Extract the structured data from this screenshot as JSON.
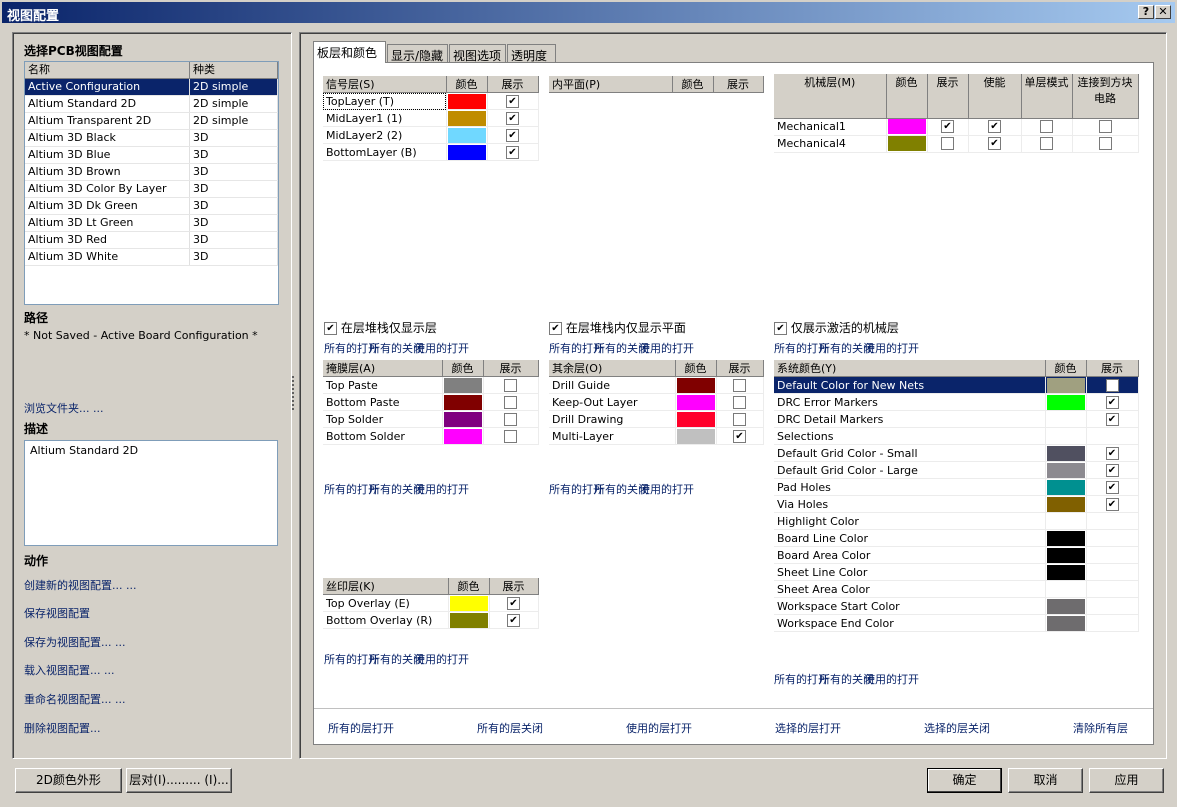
{
  "window": {
    "title": "视图配置",
    "help": "?",
    "close": "✕"
  },
  "left": {
    "heading": "选择PCB视图配置",
    "columns": [
      "名称",
      "种类"
    ],
    "configs": [
      {
        "name": "Active Configuration",
        "type": "2D simple"
      },
      {
        "name": "Altium Standard 2D",
        "type": "2D simple"
      },
      {
        "name": "Altium Transparent 2D",
        "type": "2D simple"
      },
      {
        "name": "Altium 3D Black",
        "type": "3D"
      },
      {
        "name": "Altium 3D Blue",
        "type": "3D"
      },
      {
        "name": "Altium 3D Brown",
        "type": "3D"
      },
      {
        "name": "Altium 3D Color By Layer",
        "type": "3D"
      },
      {
        "name": "Altium 3D Dk Green",
        "type": "3D"
      },
      {
        "name": "Altium 3D Lt Green",
        "type": "3D"
      },
      {
        "name": "Altium 3D Red",
        "type": "3D"
      },
      {
        "name": "Altium 3D White",
        "type": "3D"
      }
    ],
    "path_heading": "路径",
    "path_value": "* Not Saved - Active Board Configuration *",
    "browse": "浏览文件夹... ...",
    "desc_heading": "描述",
    "desc_value": "Altium Standard 2D",
    "actions_heading": "动作",
    "actions": [
      "创建新的视图配置... ...",
      "保存视图配置",
      "保存为视图配置... ...",
      "载入视图配置... ...",
      "重命名视图配置... ...",
      "删除视图配置..."
    ]
  },
  "tabs": [
    "板层和颜色",
    "显示/隐藏",
    "视图选项",
    "透明度"
  ],
  "links": {
    "all_on": "所有的打开",
    "all_off": "所有的关闭",
    "used_on": "使用的打开"
  },
  "signal": {
    "columns": [
      "信号层(S)",
      "颜色",
      "展示"
    ],
    "rows": [
      {
        "name": "TopLayer (T)",
        "color": "#ff0000",
        "checks": [
          true
        ]
      },
      {
        "name": "MidLayer1 (1)",
        "color": "#c08c00",
        "checks": [
          true
        ]
      },
      {
        "name": "MidLayer2 (2)",
        "color": "#70d8ff",
        "checks": [
          true
        ]
      },
      {
        "name": "BottomLayer (B)",
        "color": "#0000ff",
        "checks": [
          true
        ]
      }
    ]
  },
  "plane": {
    "columns": [
      "内平面(P)",
      "颜色",
      "展示"
    ],
    "rows": []
  },
  "mech": {
    "columns": [
      "机械层(M)",
      "颜色",
      "展示",
      "使能",
      "单层模式",
      "连接到方块电路"
    ],
    "rows": [
      {
        "name": "Mechanical1",
        "color": "#ff00ff",
        "checks": [
          true,
          true,
          false,
          false
        ]
      },
      {
        "name": "Mechanical4",
        "color": "#808000",
        "checks": [
          false,
          true,
          false,
          false
        ]
      }
    ]
  },
  "options": {
    "signal_only": "在层堆栈仅显示层",
    "plane_only": "在层堆栈内仅显示平面",
    "mech_only": "仅展示激活的机械层"
  },
  "mask": {
    "columns": [
      "掩膜层(A)",
      "颜色",
      "展示"
    ],
    "rows": [
      {
        "name": "Top Paste",
        "color": "#808080",
        "checks": [
          false
        ]
      },
      {
        "name": "Bottom Paste",
        "color": "#800000",
        "checks": [
          false
        ]
      },
      {
        "name": "Top Solder",
        "color": "#800080",
        "checks": [
          false
        ]
      },
      {
        "name": "Bottom Solder",
        "color": "#ff00ff",
        "checks": [
          false
        ]
      }
    ]
  },
  "other": {
    "columns": [
      "其余层(O)",
      "颜色",
      "展示"
    ],
    "rows": [
      {
        "name": "Drill Guide",
        "color": "#800000",
        "checks": [
          false
        ]
      },
      {
        "name": "Keep-Out Layer",
        "color": "#ff00ff",
        "checks": [
          false
        ]
      },
      {
        "name": "Drill Drawing",
        "color": "#ff002a",
        "checks": [
          false
        ]
      },
      {
        "name": "Multi-Layer",
        "color": "#c0c0c0",
        "checks": [
          true
        ]
      }
    ]
  },
  "silk": {
    "columns": [
      "丝印层(K)",
      "颜色",
      "展示"
    ],
    "rows": [
      {
        "name": "Top Overlay (E)",
        "color": "#ffff00",
        "checks": [
          true
        ]
      },
      {
        "name": "Bottom Overlay (R)",
        "color": "#808000",
        "checks": [
          true
        ]
      }
    ]
  },
  "system": {
    "columns": [
      "系统颜色(Y)",
      "颜色",
      "展示"
    ],
    "rows": [
      {
        "name": "Default Color for New Nets",
        "color": "#a0a080",
        "checks": [
          false
        ],
        "selected": true
      },
      {
        "name": "DRC Error Markers",
        "color": "#00ff00",
        "checks": [
          true
        ]
      },
      {
        "name": "DRC Detail Markers",
        "color": "#ffffff",
        "checks": [
          true
        ]
      },
      {
        "name": "Selections",
        "color": "#ffffff",
        "checks": [
          null
        ]
      },
      {
        "name": "Default Grid Color - Small",
        "color": "#505060",
        "checks": [
          true
        ]
      },
      {
        "name": "Default Grid Color - Large",
        "color": "#8c8a90",
        "checks": [
          true
        ]
      },
      {
        "name": "Pad Holes",
        "color": "#009090",
        "checks": [
          true
        ]
      },
      {
        "name": "Via Holes",
        "color": "#806000",
        "checks": [
          true
        ]
      },
      {
        "name": "Highlight Color",
        "color": "#ffffff",
        "checks": [
          null
        ]
      },
      {
        "name": "Board Line Color",
        "color": "#000000",
        "checks": [
          null
        ]
      },
      {
        "name": "Board Area Color",
        "color": "#000000",
        "checks": [
          null
        ]
      },
      {
        "name": "Sheet Line Color",
        "color": "#000000",
        "checks": [
          null
        ]
      },
      {
        "name": "Sheet Area Color",
        "color": "#ffffff",
        "checks": [
          null
        ]
      },
      {
        "name": "Workspace Start Color",
        "color": "#6e6c6e",
        "checks": [
          null
        ]
      },
      {
        "name": "Workspace End Color",
        "color": "#6e6c6e",
        "checks": [
          null
        ]
      }
    ]
  },
  "bottom_links": [
    "所有的层打开",
    "所有的层关闭",
    "使用的层打开",
    "选择的层打开",
    "选择的层关闭",
    "清除所有层"
  ],
  "buttons": {
    "color_2d": "2D颜色外形",
    "layer_pairs": "层对(I)......... (I)...",
    "ok": "确定",
    "cancel": "取消",
    "apply": "应用"
  }
}
